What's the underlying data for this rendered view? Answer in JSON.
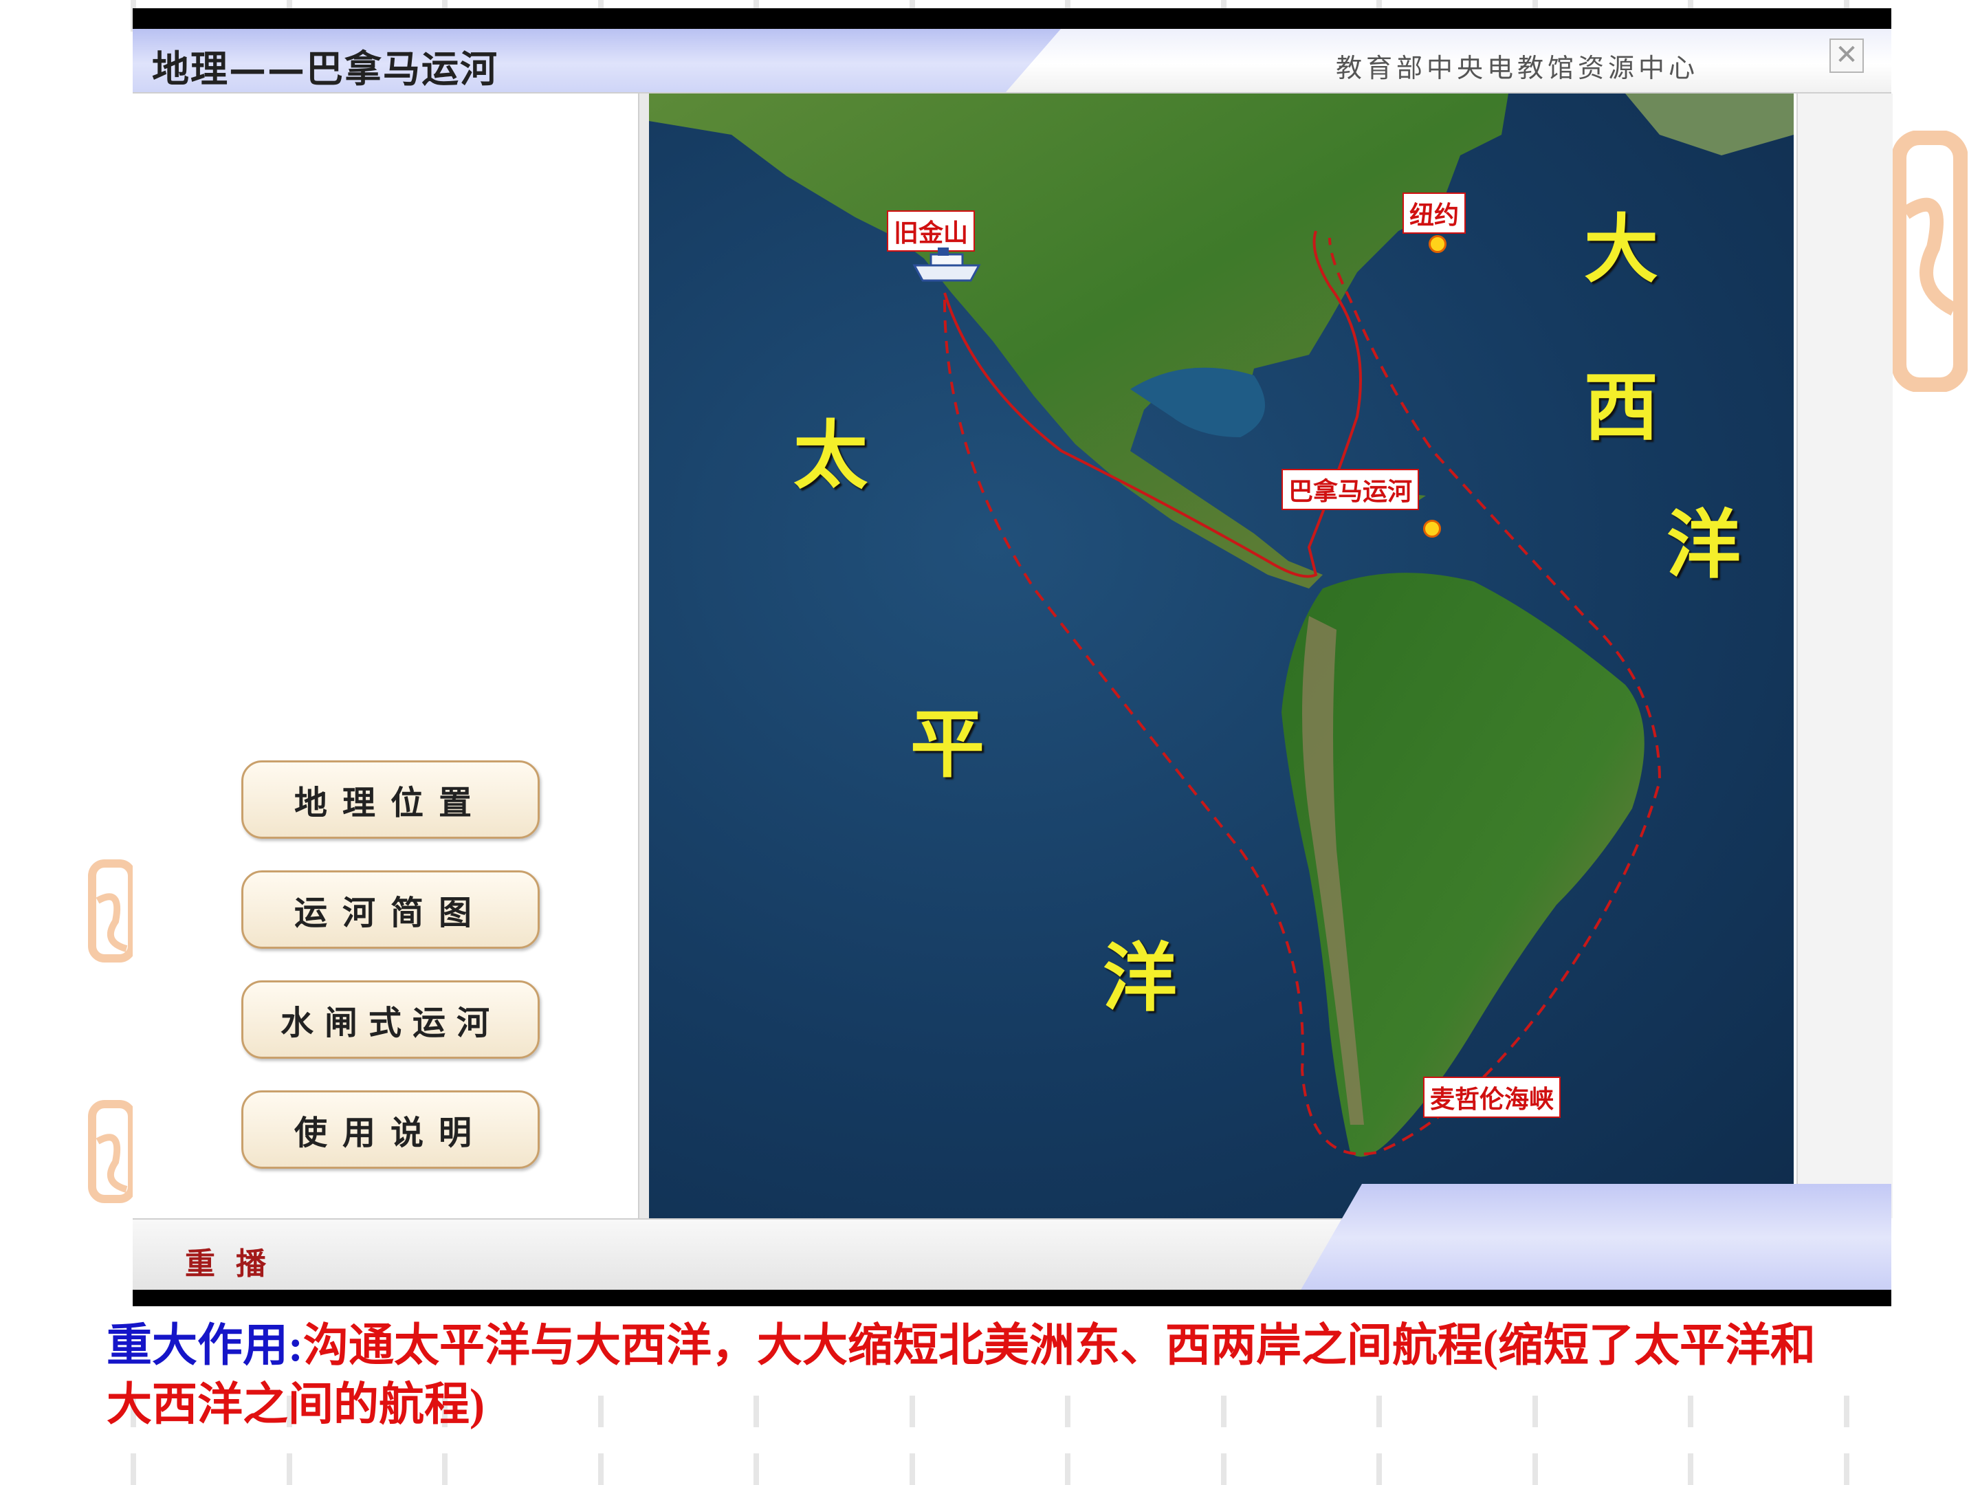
{
  "window": {
    "title": "地理——巴拿马运河",
    "publisher": "教育部中央电教馆资源中心",
    "close_icon": "✕"
  },
  "nav_buttons": [
    {
      "label": "地理位置"
    },
    {
      "label": "运河简图"
    },
    {
      "label": "水闸式运河"
    },
    {
      "label": "使用说明"
    }
  ],
  "map": {
    "ocean_labels": {
      "pacific": [
        "太",
        "平",
        "洋"
      ],
      "atlantic": [
        "大",
        "西",
        "洋"
      ]
    },
    "places": {
      "san_francisco": "旧金山",
      "new_york": "纽约",
      "panama_canal": "巴拿马运河",
      "magellan_strait": "麦哲伦海峡"
    },
    "colors": {
      "route": "#c81818",
      "ocean_label": "#f4ef2a",
      "land": "#3f7a2a"
    }
  },
  "replay_label": "重播",
  "caption": {
    "key": "重大作用",
    "colon": ":",
    "text": "沟通太平洋与大西洋，大大缩短北美洲东、西两岸之间航程(缩短了太平洋和大西洋之间的航程)"
  }
}
